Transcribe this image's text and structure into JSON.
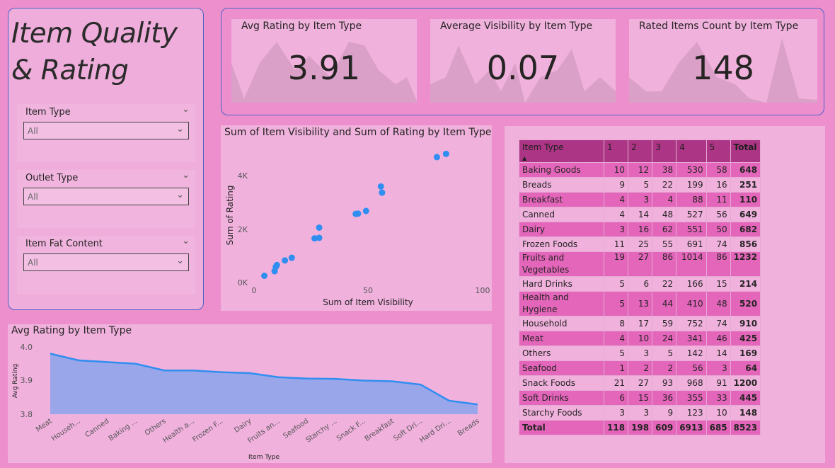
{
  "page_title": "Item Quality & Rating",
  "slicers": [
    {
      "label": "Item Type",
      "value": "All"
    },
    {
      "label": "Outlet Type",
      "value": "All"
    },
    {
      "label": "Item Fat Content",
      "value": "All"
    }
  ],
  "kpis": [
    {
      "title": "Avg Rating by Item Type",
      "value": "3.91"
    },
    {
      "title": "Average Visibility by Item Type",
      "value": "0.07"
    },
    {
      "title": "Rated Items Count by Item Type",
      "value": "148"
    }
  ],
  "colors": {
    "background": "#ee8fcd",
    "panel": "#f0b1dd",
    "accent": "#2f8ef0",
    "area_fill": "#9aa6ea",
    "header": "#ac3585",
    "row_dark": "#e466bb"
  },
  "scatter": {
    "title": "Sum of Item Visibility and Sum of Rating by Item Type",
    "xlabel": "Sum of Item Visibility",
    "ylabel": "Sum of Rating",
    "x_ticks": [
      "0",
      "50",
      "100"
    ],
    "y_ticks": [
      "0K",
      "2K",
      "4K"
    ]
  },
  "area": {
    "title": "Avg Rating by Item Type",
    "xlabel": "Item Type",
    "ylabel": "Avg Rating",
    "y_ticks": [
      "4.0",
      "3.9",
      "3.8"
    ],
    "x_labels": [
      "Meat",
      "Househ...",
      "Canned",
      "Baking ...",
      "Others",
      "Health a...",
      "Frozen F...",
      "Dairy",
      "Fruits an...",
      "Seafood",
      "Starchy ...",
      "Snack F...",
      "Breakfast",
      "Soft Dri...",
      "Hard Dri...",
      "Breads"
    ]
  },
  "table": {
    "headers": [
      "Item Type",
      "1",
      "2",
      "3",
      "4",
      "5",
      "Total"
    ],
    "rows": [
      [
        "Baking Goods",
        "10",
        "12",
        "38",
        "530",
        "58",
        "648"
      ],
      [
        "Breads",
        "9",
        "5",
        "22",
        "199",
        "16",
        "251"
      ],
      [
        "Breakfast",
        "4",
        "3",
        "4",
        "88",
        "11",
        "110"
      ],
      [
        "Canned",
        "4",
        "14",
        "48",
        "527",
        "56",
        "649"
      ],
      [
        "Dairy",
        "3",
        "16",
        "62",
        "551",
        "50",
        "682"
      ],
      [
        "Frozen Foods",
        "11",
        "25",
        "55",
        "691",
        "74",
        "856"
      ],
      [
        "Fruits and Vegetables",
        "19",
        "27",
        "86",
        "1014",
        "86",
        "1232"
      ],
      [
        "Hard Drinks",
        "5",
        "6",
        "22",
        "166",
        "15",
        "214"
      ],
      [
        "Health and Hygiene",
        "5",
        "13",
        "44",
        "410",
        "48",
        "520"
      ],
      [
        "Household",
        "8",
        "17",
        "59",
        "752",
        "74",
        "910"
      ],
      [
        "Meat",
        "4",
        "10",
        "24",
        "341",
        "46",
        "425"
      ],
      [
        "Others",
        "5",
        "3",
        "5",
        "142",
        "14",
        "169"
      ],
      [
        "Seafood",
        "1",
        "2",
        "2",
        "56",
        "3",
        "64"
      ],
      [
        "Snack Foods",
        "21",
        "27",
        "93",
        "968",
        "91",
        "1200"
      ],
      [
        "Soft Drinks",
        "6",
        "15",
        "36",
        "355",
        "33",
        "445"
      ],
      [
        "Starchy Foods",
        "3",
        "3",
        "9",
        "123",
        "10",
        "148"
      ]
    ],
    "total_row": [
      "Total",
      "118",
      "198",
      "609",
      "6913",
      "685",
      "8523"
    ]
  },
  "chart_data": [
    {
      "type": "scatter",
      "title": "Sum of Item Visibility and Sum of Rating by Item Type",
      "xlabel": "Sum of Item Visibility",
      "ylabel": "Sum of Rating",
      "xlim": [
        0,
        100
      ],
      "ylim": [
        0,
        5000
      ],
      "points": [
        {
          "x": 4.5,
          "y": 250
        },
        {
          "x": 9,
          "y": 420
        },
        {
          "x": 9.5,
          "y": 580
        },
        {
          "x": 10,
          "y": 650
        },
        {
          "x": 13.5,
          "y": 820
        },
        {
          "x": 16.5,
          "y": 920
        },
        {
          "x": 26.5,
          "y": 1640
        },
        {
          "x": 28.5,
          "y": 1660
        },
        {
          "x": 28.5,
          "y": 2040
        },
        {
          "x": 44.5,
          "y": 2550
        },
        {
          "x": 45.5,
          "y": 2560
        },
        {
          "x": 49,
          "y": 2660
        },
        {
          "x": 55.5,
          "y": 3570
        },
        {
          "x": 56,
          "y": 3340
        },
        {
          "x": 80,
          "y": 4660
        },
        {
          "x": 84,
          "y": 4780
        }
      ]
    },
    {
      "type": "area",
      "title": "Avg Rating by Item Type",
      "xlabel": "Item Type",
      "ylabel": "Avg Rating",
      "ylim": [
        3.8,
        4.0
      ],
      "categories": [
        "Meat",
        "Household",
        "Canned",
        "Baking Goods",
        "Others",
        "Health and Hygiene",
        "Frozen Foods",
        "Dairy",
        "Fruits and Vegetables",
        "Seafood",
        "Starchy Foods",
        "Snack Foods",
        "Breakfast",
        "Soft Drinks",
        "Hard Drinks",
        "Breads"
      ],
      "values": [
        3.98,
        3.96,
        3.955,
        3.95,
        3.93,
        3.93,
        3.925,
        3.922,
        3.91,
        3.906,
        3.905,
        3.9,
        3.898,
        3.888,
        3.84,
        3.829
      ]
    }
  ]
}
